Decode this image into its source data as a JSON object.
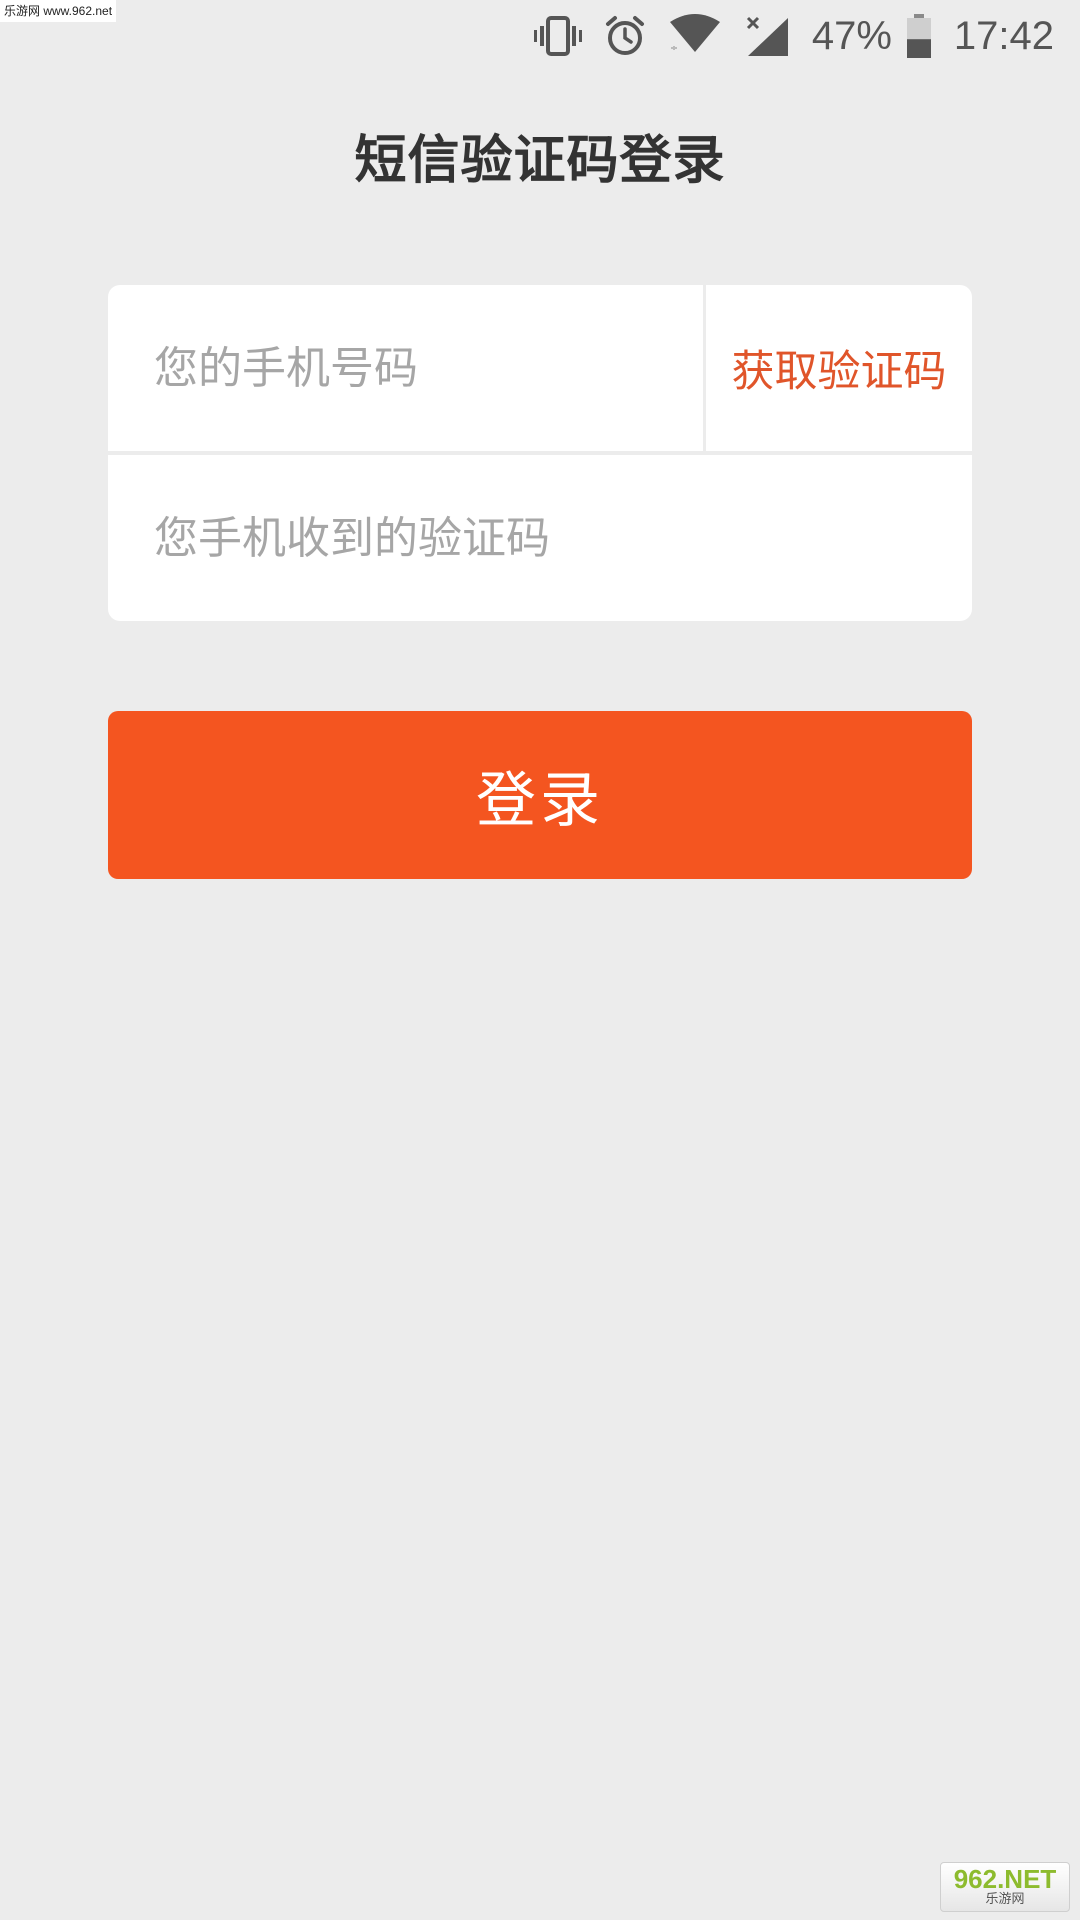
{
  "watermark": {
    "top_left": "乐游网 www.962.net",
    "bottom_right_logo": "962.NET",
    "bottom_right_sub": "乐游网"
  },
  "status_bar": {
    "battery_percent": "47%",
    "battery_level": 0.47,
    "time": "17:42",
    "icons": [
      "vibrate-icon",
      "alarm-icon",
      "wifi-icon",
      "signal-icon",
      "battery-icon"
    ]
  },
  "page": {
    "title": "短信验证码登录"
  },
  "form": {
    "phone_placeholder": "您的手机号码",
    "get_code_label": "获取验证码",
    "code_placeholder": "您手机收到的验证码"
  },
  "actions": {
    "login_label": "登录"
  },
  "colors": {
    "background": "#ececec",
    "accent": "#f45520",
    "get_code_text": "#e0552a",
    "title_text": "#333333",
    "placeholder": "#a6a6a6"
  }
}
